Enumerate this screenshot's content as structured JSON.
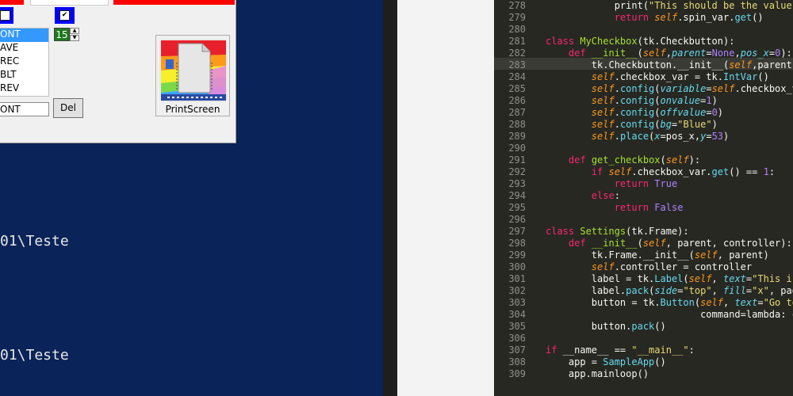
{
  "tk_app": {
    "listbox_items": [
      "ONT",
      "AVE",
      "REC",
      "BLT",
      "REV"
    ],
    "selected_index": 0,
    "spinbox_value": "15",
    "entry_value": "ONT",
    "delete_label": "Del",
    "checkbox_checked": true,
    "printscreen_label": "PrintScreen",
    "colors": {
      "checkbox_bg": "#0000ff",
      "spinbox_bg": "#1f7a1f",
      "top_strip": "#ff0000"
    }
  },
  "terminal": {
    "lines": [
      "01\\Teste",
      "01\\Teste"
    ]
  },
  "editor": {
    "current_line": "283",
    "lines": [
      {
        "n": "278",
        "c": "            print(\"This should be the value of s"
      },
      {
        "n": "279",
        "c": "            return self.spin_var.get()"
      },
      {
        "n": "280",
        "c": ""
      },
      {
        "n": "281",
        "c": "class MyCheckbox(tk.Checkbutton):"
      },
      {
        "n": "282",
        "c": "    def __init__(self,parent=None,pos_x=0):"
      },
      {
        "n": "283",
        "c": "        tk.Checkbutton.__init__(self,parent)"
      },
      {
        "n": "284",
        "c": "        self.checkbox_var = tk.IntVar()"
      },
      {
        "n": "285",
        "c": "        self.config(variable=self.checkbox_v"
      },
      {
        "n": "286",
        "c": "        self.config(onvalue=1)"
      },
      {
        "n": "287",
        "c": "        self.config(offvalue=0)"
      },
      {
        "n": "288",
        "c": "        self.config(bg=\"Blue\")"
      },
      {
        "n": "289",
        "c": "        self.place(x=pos_x,y=53)"
      },
      {
        "n": "290",
        "c": ""
      },
      {
        "n": "291",
        "c": "    def get_checkbox(self):"
      },
      {
        "n": "292",
        "c": "        if self.checkbox_var.get() == 1:"
      },
      {
        "n": "293",
        "c": "            return True"
      },
      {
        "n": "294",
        "c": "        else:"
      },
      {
        "n": "295",
        "c": "            return False"
      },
      {
        "n": "296",
        "c": ""
      },
      {
        "n": "297",
        "c": "class Settings(tk.Frame):"
      },
      {
        "n": "298",
        "c": "    def __init__(self, parent, controller):"
      },
      {
        "n": "299",
        "c": "        tk.Frame.__init__(self, parent)"
      },
      {
        "n": "300",
        "c": "        self.controller = controller"
      },
      {
        "n": "301",
        "c": "        label = tk.Label(self, text=\"This is"
      },
      {
        "n": "302",
        "c": "        label.pack(side=\"top\", fill=\"x\", pad"
      },
      {
        "n": "303",
        "c": "        button = tk.Button(self, text=\"Go to"
      },
      {
        "n": "304",
        "c": "                           command=lambda: c"
      },
      {
        "n": "305",
        "c": "        button.pack()"
      },
      {
        "n": "306",
        "c": ""
      },
      {
        "n": "307",
        "c": "if __name__ == \"__main__\":"
      },
      {
        "n": "308",
        "c": "    app = SampleApp()"
      },
      {
        "n": "309",
        "c": "    app.mainloop()"
      }
    ],
    "colors": {
      "background": "#272822",
      "keyword": "#f92672",
      "string": "#e6db74",
      "function": "#a6e22e",
      "number": "#ae81ff",
      "self": "#fd971f",
      "builtin": "#66d9ef"
    }
  }
}
